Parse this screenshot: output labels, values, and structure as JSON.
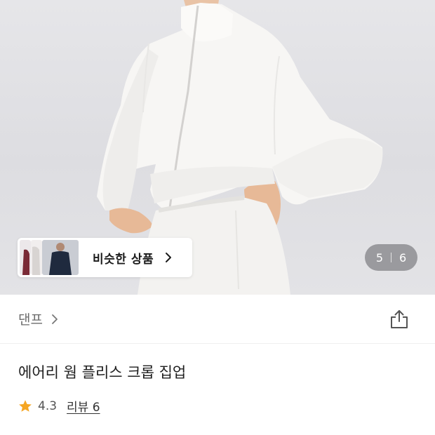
{
  "hero": {
    "similar": {
      "label": "비슷한 상품"
    },
    "pager": {
      "current": "5",
      "total": "6"
    }
  },
  "brand": {
    "name": "댄프"
  },
  "product": {
    "title": "에어리 웜 플리스 크롭 집업",
    "rating": "4.3",
    "review_label": "리뷰 6"
  },
  "colors": {
    "star": "#f5a623",
    "pager_bg": "#6e6e73",
    "hero_bg": "#e2e2e5"
  },
  "icons": {
    "similar": "chevron-right-icon",
    "brand": "chevron-right-icon",
    "share": "share-icon",
    "rating": "star-icon"
  }
}
